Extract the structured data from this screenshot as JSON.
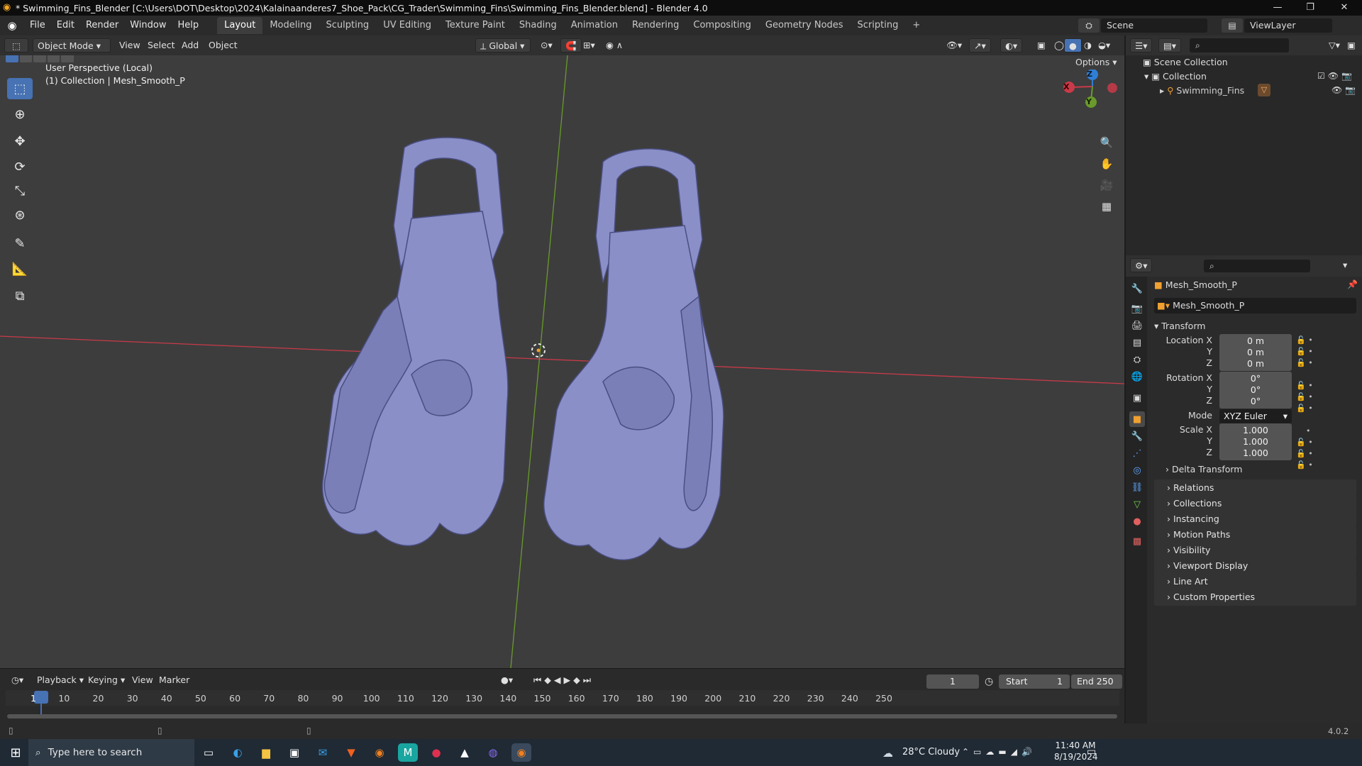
{
  "window": {
    "title": "* Swimming_Fins_Blender [C:\\Users\\DOT\\Desktop\\2024\\Kalainaanderes7_Shoe_Pack\\CG_Trader\\Swimming_Fins\\Swimming_Fins_Blender.blend] - Blender 4.0",
    "minimize": "—",
    "maximize": "❐",
    "close": "✕"
  },
  "menu": [
    "File",
    "Edit",
    "Render",
    "Window",
    "Help"
  ],
  "workspaces": [
    "Layout",
    "Modeling",
    "Sculpting",
    "UV Editing",
    "Texture Paint",
    "Shading",
    "Animation",
    "Rendering",
    "Compositing",
    "Geometry Nodes",
    "Scripting",
    "+"
  ],
  "active_workspace": "Layout",
  "scene": {
    "label": "Scene",
    "view_layer": "ViewLayer"
  },
  "viewport_header": {
    "mode": "Object Mode",
    "items": [
      "View",
      "Select",
      "Add",
      "Object"
    ],
    "transform_orientation": "Global",
    "options": "Options"
  },
  "viewport": {
    "perspective": "User Perspective (Local)",
    "collection_line": "(1) Collection | Mesh_Smooth_P",
    "gizmo": {
      "x": "X",
      "y": "Y",
      "z": "Z"
    }
  },
  "outliner": {
    "root": "Scene Collection",
    "collection": "Collection",
    "object": "Swimming_Fins"
  },
  "properties": {
    "object_name": "Mesh_Smooth_P",
    "data_name": "Mesh_Smooth_P",
    "transform_label": "Transform",
    "location_label": "Location X",
    "rotation_label": "Rotation X",
    "scale_label": "Scale X",
    "y_label": "Y",
    "z_label": "Z",
    "mode_label": "Mode",
    "location": [
      "0 m",
      "0 m",
      "0 m"
    ],
    "rotation": [
      "0°",
      "0°",
      "0°"
    ],
    "mode": "XYZ Euler",
    "scale": [
      "1.000",
      "1.000",
      "1.000"
    ],
    "delta_transform": "Delta Transform",
    "panels": [
      "Relations",
      "Collections",
      "Instancing",
      "Motion Paths",
      "Visibility",
      "Viewport Display",
      "Line Art",
      "Custom Properties"
    ]
  },
  "timeline": {
    "menus": [
      "Playback",
      "Keying",
      "View",
      "Marker"
    ],
    "current_frame": "1",
    "start_label": "Start",
    "start": "1",
    "end_label": "End",
    "end": "250",
    "ticks": [
      "1",
      "10",
      "20",
      "30",
      "40",
      "50",
      "60",
      "70",
      "80",
      "90",
      "100",
      "110",
      "120",
      "130",
      "140",
      "150",
      "160",
      "170",
      "180",
      "190",
      "200",
      "210",
      "220",
      "230",
      "240",
      "250"
    ]
  },
  "status": {
    "version": "4.0.2"
  },
  "taskbar": {
    "search_placeholder": "Type here to search",
    "weather": "28°C  Cloudy",
    "time": "11:40 AM",
    "date": "8/19/2024"
  },
  "colors": {
    "accent": "#4772b3",
    "mesh": "#8a8fc8",
    "x_axis": "#c93a49",
    "y_axis": "#6a9a2c",
    "z_axis": "#2f7fd6"
  }
}
